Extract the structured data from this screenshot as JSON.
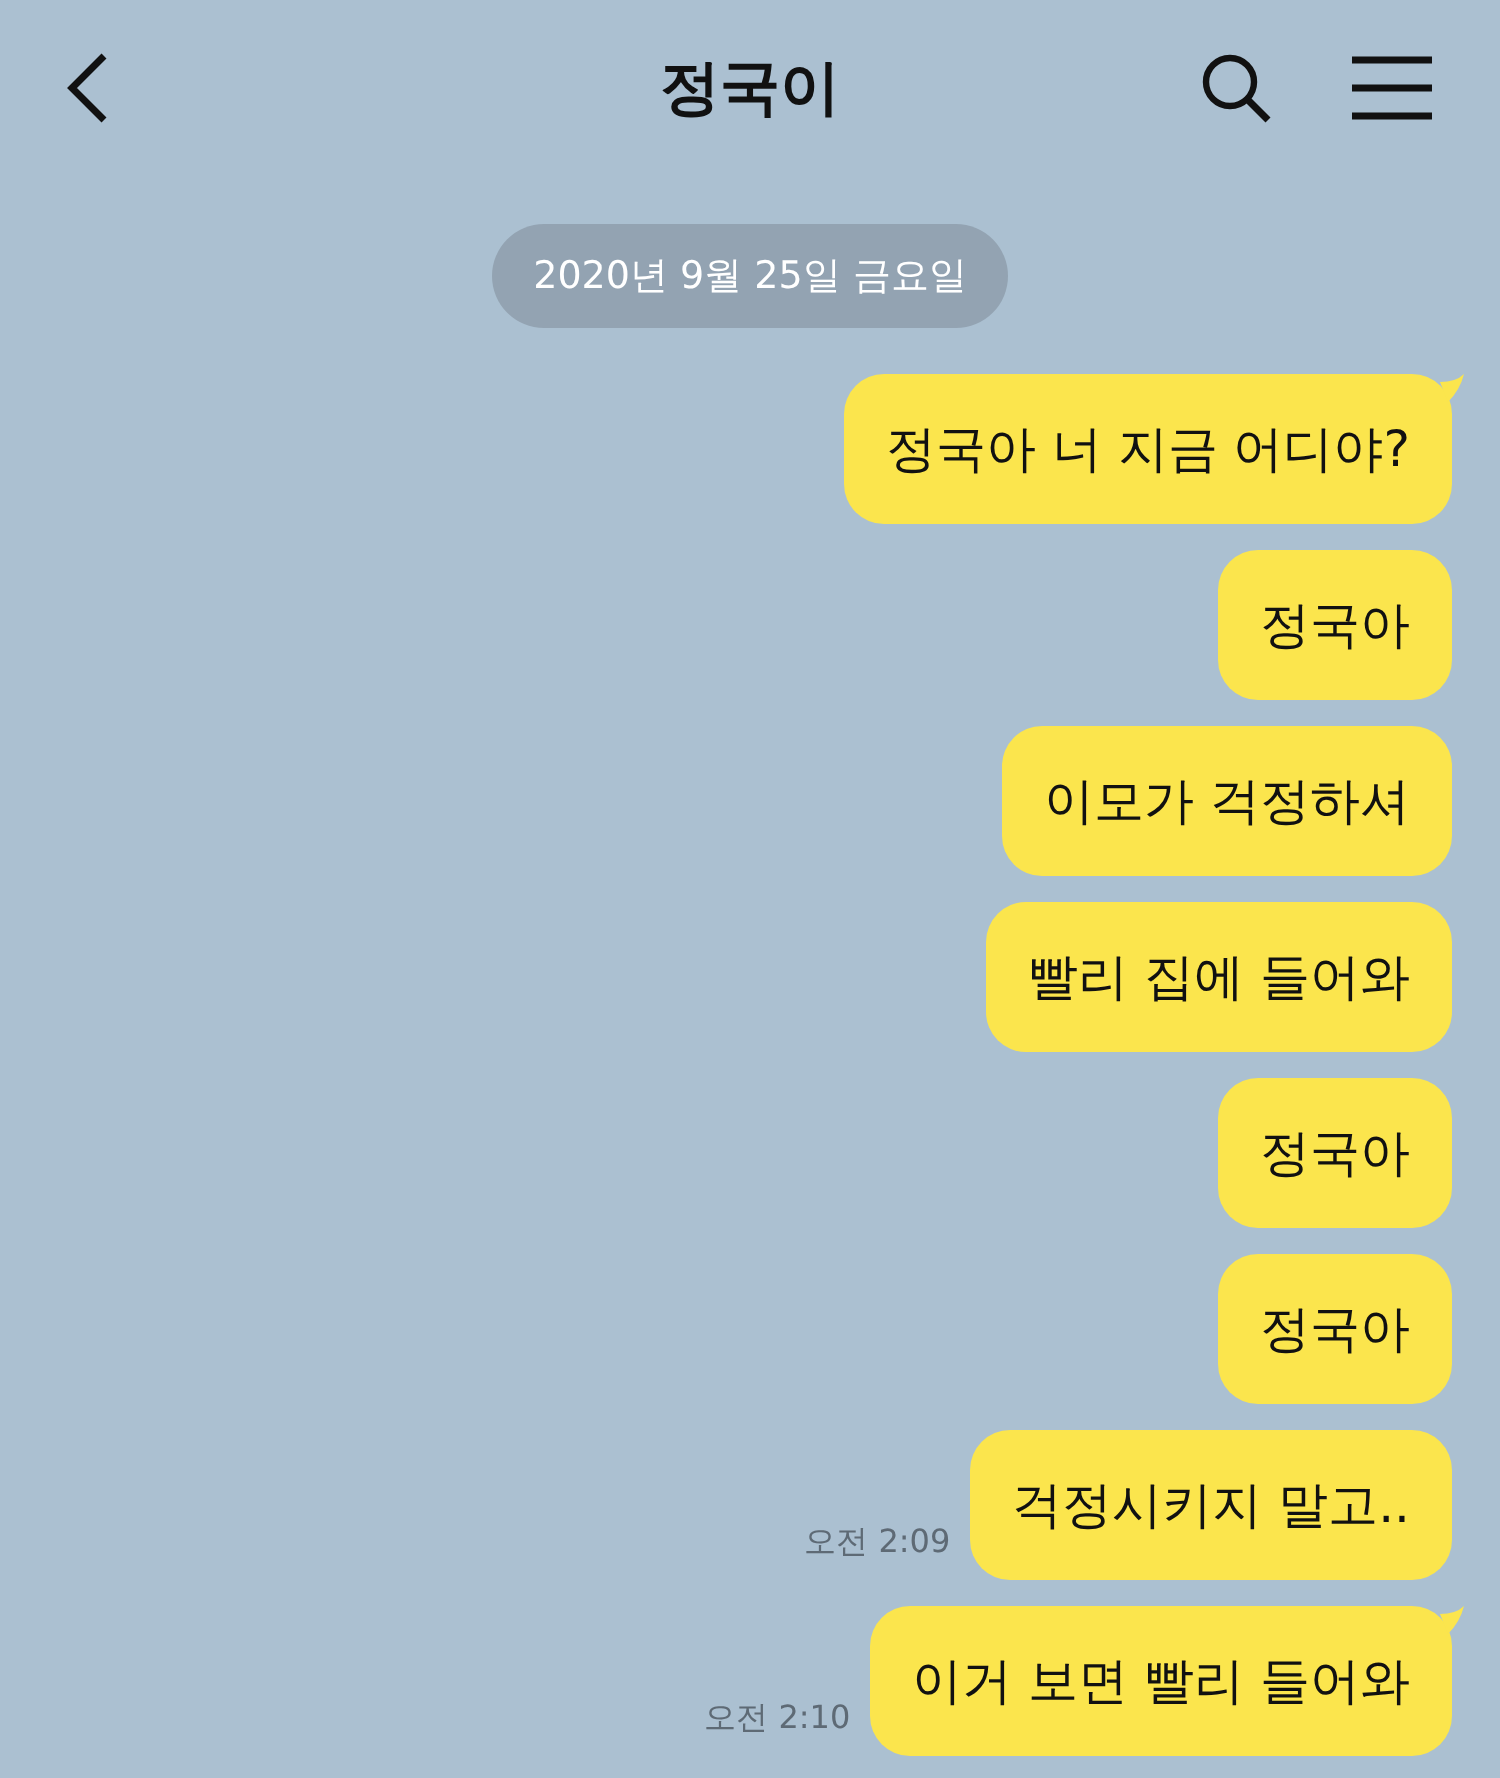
{
  "header": {
    "title": "정국이"
  },
  "date_divider": "2020년 9월 25일 금요일",
  "messages": [
    {
      "text": "정국아 너 지금 어디야?",
      "tail": true
    },
    {
      "text": "정국아",
      "tail": false
    },
    {
      "text": "이모가 걱정하셔",
      "tail": false
    },
    {
      "text": "빨리 집에 들어와",
      "tail": false
    },
    {
      "text": "정국아",
      "tail": false
    },
    {
      "text": "정국아",
      "tail": false
    },
    {
      "text": "걱정시키지 말고..",
      "tail": false,
      "time": "오전 2:09"
    },
    {
      "text": "이거 보면 빨리 들어와",
      "tail": true,
      "time": "오전 2:10"
    }
  ]
}
